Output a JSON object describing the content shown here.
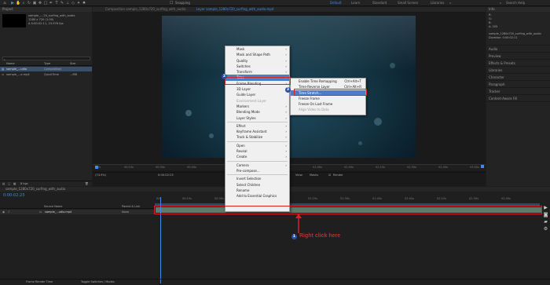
{
  "workspaces": [
    "Default",
    "Learn",
    "Standard",
    "Small Screen",
    "Libraries"
  ],
  "search_placeholder": "Search Help",
  "snapping_label": "Snapping",
  "project": {
    "tab": "Project",
    "selected_name": "sample_....20_surfing_with_audio",
    "meta": [
      "1280 x 720 (1.00)",
      "Δ 0:00:02:11, 23.976 fps"
    ],
    "col_name": "Name",
    "col_type": "Type",
    "col_size": "Size",
    "items": [
      {
        "name": "sample_...udio",
        "type": "Composition",
        "size": ""
      },
      {
        "name": "sample_...o.mp4",
        "type": "QuickTime",
        "size": "...MB"
      }
    ],
    "bpc": "8 bpc"
  },
  "comp_tabs": [
    "Composition sample_1280x720_surfing_with_audio",
    "Layer sample_1280x720_surfing_with_audio.mp4"
  ],
  "viewer": {
    "zoom": "(74.9%)",
    "time": "0:00:02:23",
    "view": "View:",
    "masks": "Masks",
    "render": "Render",
    "ruler_ticks": [
      "0s",
      "00:15s",
      "00:30s",
      "00:45s",
      "01:00s",
      "01:15s",
      "01:30s",
      "01:45s",
      "02:00s",
      "02:15s",
      "02:30s",
      "02:45s",
      "03:00s"
    ]
  },
  "right_panel": {
    "info_tab": "Info",
    "rgb": [
      "R:",
      "G:",
      "B:",
      "A: 255"
    ],
    "file": "sample_1280x720_surfing_with_audio",
    "duration": "Duration: 0:00:02:11",
    "items": [
      "Audio",
      "Preview",
      "Effects & Presets",
      "Libraries",
      "Character",
      "Paragraph",
      "Tracker",
      "Content-Aware Fill"
    ]
  },
  "context_menu": {
    "items": [
      {
        "label": "Mask",
        "arrow": true
      },
      {
        "label": "Mask and Shape Path",
        "arrow": true
      },
      {
        "label": "Quality",
        "arrow": true
      },
      {
        "label": "Switches",
        "arrow": true
      },
      {
        "label": "Transform",
        "arrow": true
      },
      {
        "label": "Time",
        "arrow": true,
        "highlight": true
      },
      {
        "label": "Frame Blending",
        "arrow": true
      },
      {
        "label": "3D Layer"
      },
      {
        "label": "Guide Layer"
      },
      {
        "label": "Environment Layer",
        "disabled": true
      },
      {
        "label": "Markers",
        "arrow": true
      },
      {
        "label": "Blending Mode",
        "arrow": true
      },
      {
        "label": "Layer Styles",
        "arrow": true
      },
      {
        "sep": true
      },
      {
        "label": "Effect",
        "arrow": true
      },
      {
        "label": "Keyframe Assistant",
        "arrow": true
      },
      {
        "label": "Track & Stabilize",
        "arrow": true
      },
      {
        "sep": true
      },
      {
        "label": "Open",
        "arrow": true
      },
      {
        "label": "Reveal",
        "arrow": true
      },
      {
        "label": "Create",
        "arrow": true
      },
      {
        "sep": true
      },
      {
        "label": "Camera",
        "arrow": true
      },
      {
        "label": "Pre-compose..."
      },
      {
        "sep": true
      },
      {
        "label": "Invert Selection"
      },
      {
        "label": "Select Children"
      },
      {
        "label": "Rename"
      },
      {
        "label": "Add to Essential Graphics"
      }
    ]
  },
  "time_submenu": {
    "items": [
      {
        "label": "Enable Time Remapping",
        "shortcut": "Ctrl+Alt+T"
      },
      {
        "label": "Time-Reverse Layer",
        "shortcut": "Ctrl+Alt+R"
      },
      {
        "label": "Time Stretch...",
        "shortcut": "",
        "highlight": true
      },
      {
        "label": "Freeze Frame",
        "shortcut": ""
      },
      {
        "label": "Freeze On Last Frame",
        "shortcut": ""
      },
      {
        "label": "Align Video to Data",
        "shortcut": "",
        "disabled": true
      }
    ]
  },
  "timeline": {
    "tab": "sample_1280x720_surfing_with_audio",
    "time": "0:00:02:23",
    "col_layer": "Source Name",
    "col_parent": "Parent & Link",
    "layer_name": "sample_...udio.mp4",
    "parent": "None",
    "ruler_ticks": [
      "00s",
      "00:15s",
      "00:30s",
      "00:45s",
      "01:00s",
      "01:15s",
      "01:30s",
      "01:45s",
      "02:00s",
      "02:15s",
      "02:30s",
      "02:45s"
    ],
    "footer_left": "Frame Render Time",
    "footer_mid": "Toggle Switches / Modes"
  },
  "annotation": {
    "badges": [
      "1",
      "2",
      "3"
    ],
    "label": "Right click here"
  },
  "colors": {
    "accent": "#3c8ee8",
    "annotation": "#d8202a",
    "badge": "#2c4ea8",
    "layer_bar": "#5d7a6a"
  }
}
